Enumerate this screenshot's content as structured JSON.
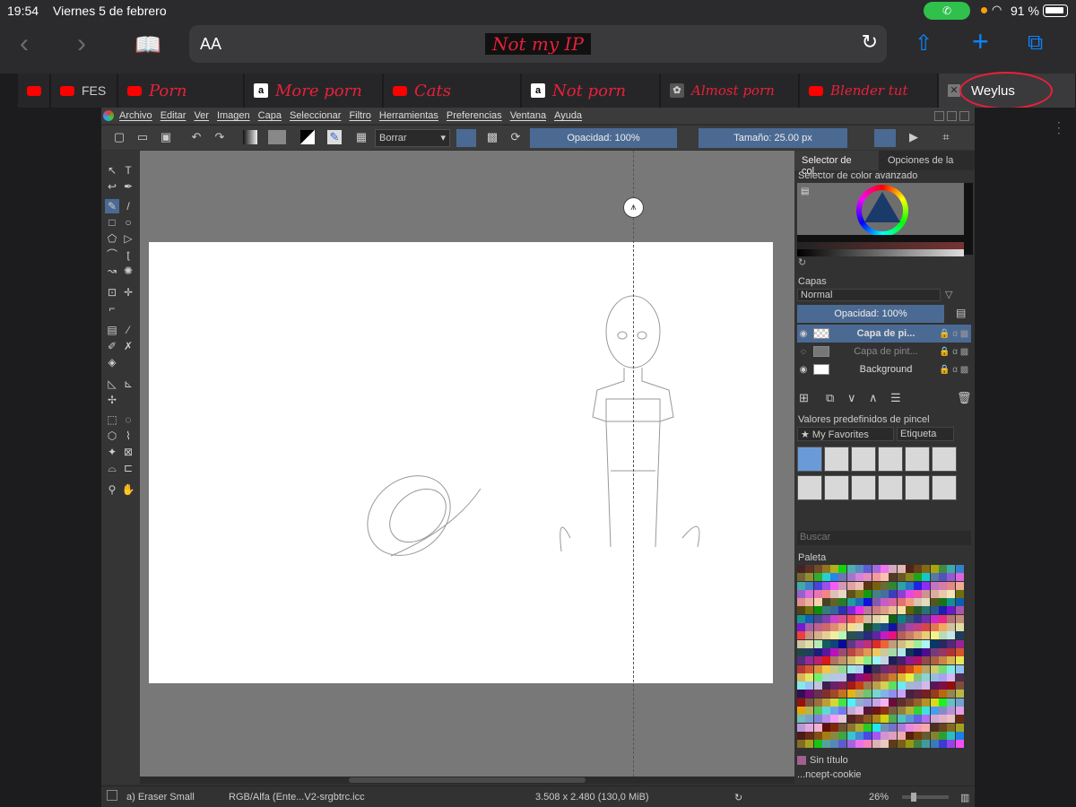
{
  "status": {
    "time": "19:54",
    "date": "Viernes 5 de febrero",
    "battery_pct": "91 %",
    "call_icon": "phone-icon",
    "accent": "#30c04c"
  },
  "safari": {
    "aa": "AA",
    "url": "Not my IP",
    "icons": [
      "back-icon",
      "forward-icon",
      "bookmarks-icon",
      "reload-icon",
      "share-icon",
      "new-tab-icon",
      "tabs-icon"
    ]
  },
  "tabs": [
    {
      "label": "FES",
      "icon": "youtube",
      "white": true
    },
    {
      "label": "Porn",
      "icon": "youtube"
    },
    {
      "label": "More porn",
      "icon": "amazon"
    },
    {
      "label": "Cats",
      "icon": "youtube"
    },
    {
      "label": "Not porn",
      "icon": "amazon"
    },
    {
      "label": "Almost porn",
      "icon": "generic"
    },
    {
      "label": "Blender tut",
      "icon": "youtube"
    },
    {
      "label": "Weylus",
      "icon": "close",
      "active": true
    }
  ],
  "krita": {
    "menu": [
      "Archivo",
      "Editar",
      "Ver",
      "Imagen",
      "Capa",
      "Seleccionar",
      "Filtro",
      "Herramientas",
      "Preferencias",
      "Ventana",
      "Ayuda"
    ],
    "toolbar": {
      "blend_mode": "Borrar",
      "opacity": "Opacidad: 100%",
      "size": "Tamaño: 25.00 px"
    },
    "dock_tabs": [
      "Selector de col...",
      "Opciones de la ..."
    ],
    "color_selector_title": "Selector de color avanzado",
    "layers": {
      "title": "Capas",
      "mode": "Normal",
      "opacity": "Opacidad:  100%",
      "items": [
        {
          "name": "Capa de pi...",
          "selected": true
        },
        {
          "name": "Capa de pint...",
          "dim": true
        },
        {
          "name": "Background"
        }
      ]
    },
    "presets": {
      "title": "Valores predefinidos de pincel",
      "favorites": "★ My Favorites",
      "tag": "Etiqueta",
      "search_placeholder": "Buscar"
    },
    "palette": {
      "title": "Paleta",
      "name": "Sin título",
      "resource": "...ncept-cookie"
    },
    "statusbar": {
      "brush": "a) Eraser Small",
      "colorspace": "RGB/Alfa (Ente...V2-srgbtrc.icc",
      "dimensions": "3.508 x 2.480 (130,0 MiB)",
      "zoom": "26%"
    }
  }
}
